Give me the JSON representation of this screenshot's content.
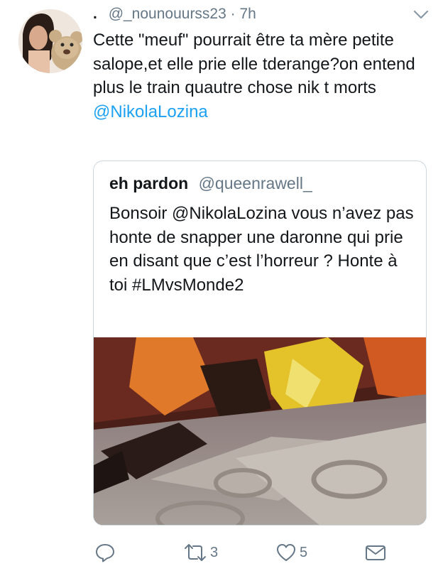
{
  "tweet": {
    "author_display": ".",
    "author_handle": "@_nounouurss23",
    "separator": "·",
    "time": "7h",
    "text": "Cette \"meuf\" pourrait être ta mère petite salope,et elle prie elle tderange?on entend plus le train quautre chose nik t morts",
    "mention": "@NikolaLozina"
  },
  "quoted": {
    "name": "eh pardon",
    "handle": "@queenrawell_",
    "text": "Bonsoir @NikolaLozina vous n’avez pas honte de snapper une daronne qui prie en disant que c’est l’horreur ? Honte à toi #LMvsMonde2"
  },
  "actions": {
    "reply_icon": "reply-icon",
    "retweet_icon": "retweet-icon",
    "retweet_count": "3",
    "like_icon": "heart-icon",
    "like_count": "5",
    "dm_icon": "envelope-icon"
  },
  "colors": {
    "link": "#1da1f2",
    "muted": "#657786",
    "border": "#ccd6dd"
  }
}
